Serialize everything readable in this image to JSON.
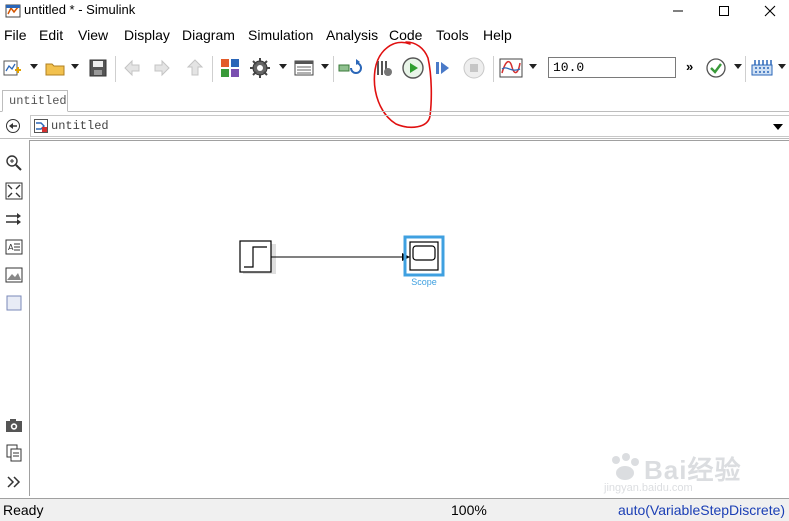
{
  "window": {
    "title": "untitled * - Simulink"
  },
  "menu": [
    "File",
    "Edit",
    "View",
    "Display",
    "Diagram",
    "Simulation",
    "Analysis",
    "Code",
    "Tools",
    "Help"
  ],
  "toolbar": {
    "stop_time": "10.0",
    "overflow": "»"
  },
  "tab": {
    "label": "untitled"
  },
  "breadcrumb": {
    "path": "untitled"
  },
  "model": {
    "blocks": [
      {
        "type": "Step",
        "label": ""
      },
      {
        "type": "Scope",
        "label": "Scope"
      }
    ]
  },
  "status": {
    "state": "Ready",
    "zoom": "100%",
    "solver": "auto(VariableStepDiscrete)"
  },
  "watermark": {
    "text": "Bai经验",
    "sub": "jingyan.baidu.com"
  },
  "colors": {
    "run_green": "#2e9e2e",
    "scope_selection": "#3fa0e0",
    "annotation_red": "#e01010",
    "solver_link": "#1b3fb5"
  }
}
